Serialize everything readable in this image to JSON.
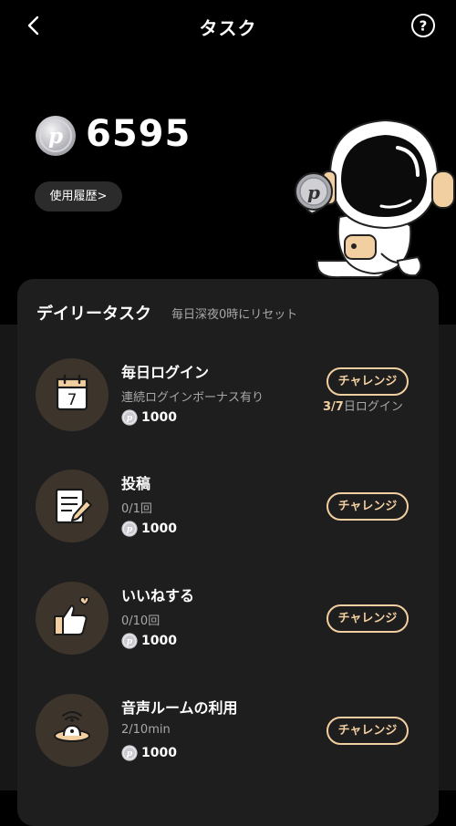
{
  "header": {
    "title": "タスク",
    "back_icon": "chevron-left-icon",
    "help_icon": "question-circle-icon"
  },
  "balance": {
    "points": "6595",
    "history_label": "使用履歴>",
    "coin_icon": "p-coin-icon"
  },
  "mascot": {
    "icon": "astronaut-mascot-icon"
  },
  "daily": {
    "title": "デイリータスク",
    "subtitle": "毎日深夜0時にリセット",
    "tasks": [
      {
        "name": "毎日ログイン",
        "desc": "連続ログインボーナス有り",
        "reward": "1000",
        "button": "チャレンジ",
        "progress_current": "3/7",
        "progress_suffix": "日ログイン",
        "icon": "calendar-icon"
      },
      {
        "name": "投稿",
        "desc": "0/1回",
        "reward": "1000",
        "button": "チャレンジ",
        "icon": "post-edit-icon"
      },
      {
        "name": "いいねする",
        "desc": "0/10回",
        "reward": "1000",
        "button": "チャレンジ",
        "icon": "thumbs-up-icon"
      },
      {
        "name": "音声ルームの利用",
        "desc": "2/10min",
        "reward": "1000",
        "button": "チャレンジ",
        "icon": "voice-room-icon"
      }
    ]
  },
  "colors": {
    "accent": "#f2cfa1",
    "card": "#1f1e1e",
    "icon_bg": "#3d342c",
    "muted": "#a8a8a8"
  }
}
